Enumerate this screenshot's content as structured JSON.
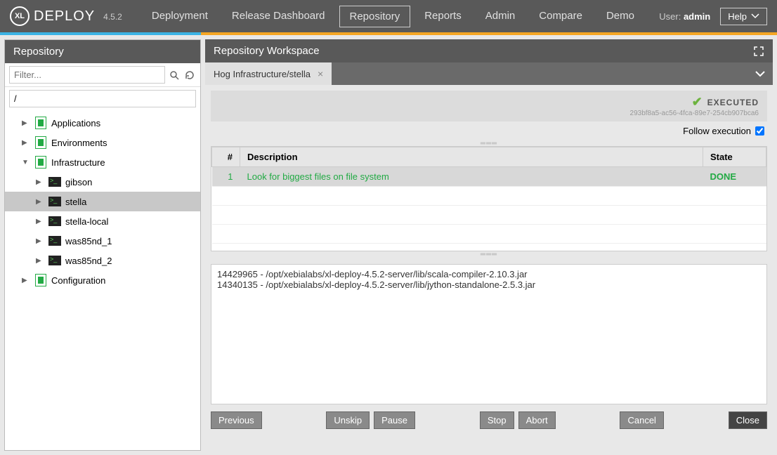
{
  "brand": {
    "badge": "XL",
    "name": "DEPLOY",
    "version": "4.5.2"
  },
  "nav": {
    "items": [
      "Deployment",
      "Release Dashboard",
      "Repository",
      "Reports",
      "Admin",
      "Compare",
      "Demo"
    ],
    "active": "Repository"
  },
  "user": {
    "label": "User:",
    "name": "admin"
  },
  "help_label": "Help",
  "sidebar": {
    "title": "Repository",
    "filter_placeholder": "Filter...",
    "path": "/",
    "tree": [
      {
        "label": "Applications",
        "type": "folder",
        "depth": 1,
        "expanded": false
      },
      {
        "label": "Environments",
        "type": "folder",
        "depth": 1,
        "expanded": false
      },
      {
        "label": "Infrastructure",
        "type": "folder",
        "depth": 1,
        "expanded": true
      },
      {
        "label": "gibson",
        "type": "host",
        "depth": 2,
        "expanded": false
      },
      {
        "label": "stella",
        "type": "host",
        "depth": 2,
        "expanded": false,
        "selected": true
      },
      {
        "label": "stella-local",
        "type": "host",
        "depth": 2,
        "expanded": false
      },
      {
        "label": "was85nd_1",
        "type": "host",
        "depth": 2,
        "expanded": false
      },
      {
        "label": "was85nd_2",
        "type": "host",
        "depth": 2,
        "expanded": false
      },
      {
        "label": "Configuration",
        "type": "folder",
        "depth": 1,
        "expanded": false
      }
    ]
  },
  "workspace": {
    "title": "Repository Workspace",
    "tab": "Hog Infrastructure/stella",
    "status": {
      "label": "EXECUTED",
      "id": "293bf8a5-ac56-4fca-89e7-254cb907bca6"
    },
    "follow_label": "Follow execution",
    "follow_checked": true,
    "table": {
      "headers": {
        "num": "#",
        "desc": "Description",
        "state": "State"
      },
      "rows": [
        {
          "n": "1",
          "desc": "Look for biggest files on file system",
          "state": "DONE"
        }
      ]
    },
    "log": "14429965 - /opt/xebialabs/xl-deploy-4.5.2-server/lib/scala-compiler-2.10.3.jar\n14340135 - /opt/xebialabs/xl-deploy-4.5.2-server/lib/jython-standalone-2.5.3.jar",
    "buttons": {
      "previous": "Previous",
      "unskip": "Unskip",
      "pause": "Pause",
      "stop": "Stop",
      "abort": "Abort",
      "cancel": "Cancel",
      "close": "Close"
    }
  }
}
